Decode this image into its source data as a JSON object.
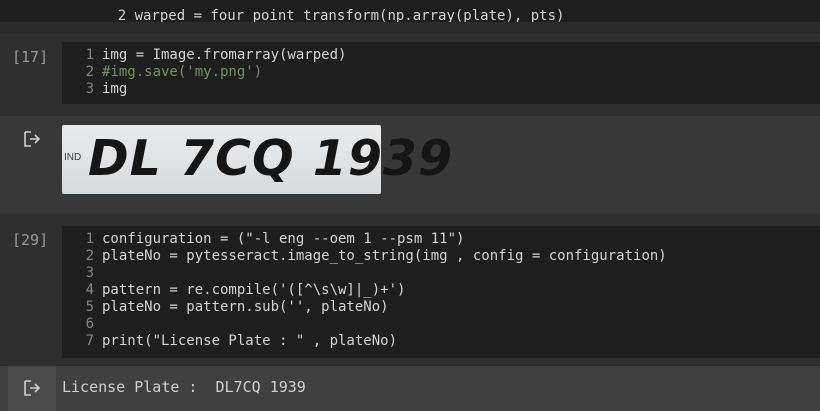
{
  "cells": [
    {
      "partial_line": "2 warped = four_point_transform(np.array(plate), pts)"
    },
    {
      "label": "[17]",
      "lines": [
        {
          "num": "1",
          "text": "img = Image.fromarray(warped)"
        },
        {
          "num": "2",
          "text": "#img.save('my.png')"
        },
        {
          "num": "3",
          "text": "img"
        }
      ],
      "output_plate": {
        "prefix": "IND",
        "text": "DL 7CQ 1939"
      }
    },
    {
      "label": "[29]",
      "lines": [
        {
          "num": "1",
          "text": "configuration = (\"-l eng --oem 1 --psm 11\")"
        },
        {
          "num": "2",
          "text": "plateNo = pytesseract.image_to_string(img , config = configuration)"
        },
        {
          "num": "3",
          "text": ""
        },
        {
          "num": "4",
          "text": "pattern = re.compile('([^\\s\\w]|_)+')"
        },
        {
          "num": "5",
          "text": "plateNo = pattern.sub('', plateNo)"
        },
        {
          "num": "6",
          "text": ""
        },
        {
          "num": "7",
          "text": "print(\"License Plate : \" , plateNo)"
        }
      ],
      "output_text": "License Plate :  DL7CQ 1939"
    }
  ],
  "icons": {
    "output": "output-arrow-icon"
  },
  "colors": {
    "background": "#383838",
    "editor": "#1e1e1e",
    "output_bar": "#404040"
  }
}
